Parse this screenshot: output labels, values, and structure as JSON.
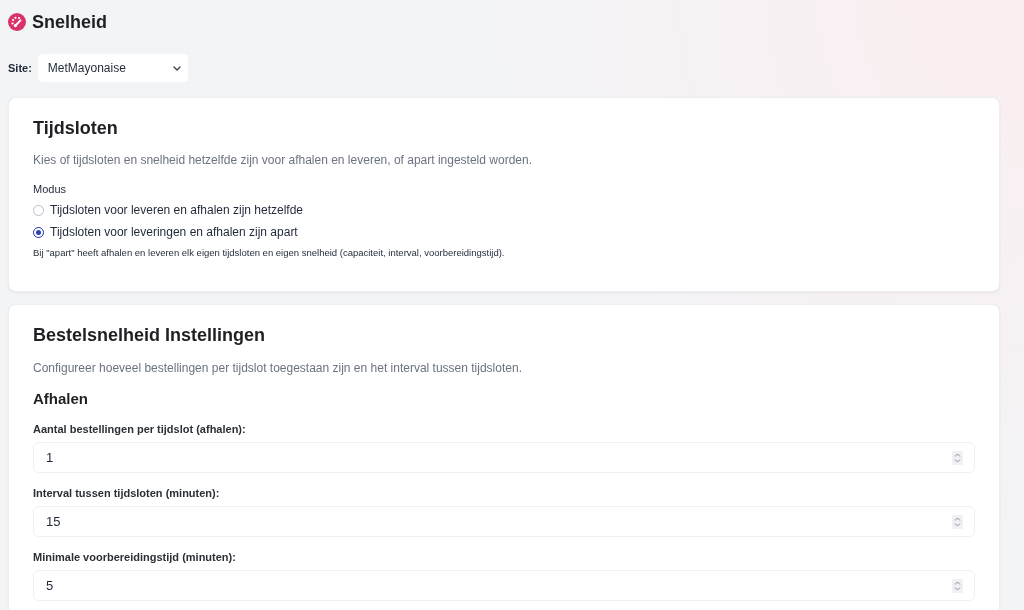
{
  "header": {
    "title": "Snelheid"
  },
  "site": {
    "label": "Site:",
    "value": "MetMayonaise"
  },
  "sections": [
    {
      "kind": "mode",
      "title": "Tijdsloten",
      "description": "Kies of tijdsloten en snelheid hetzelfde zijn voor afhalen en leveren, of apart ingesteld worden.",
      "group_label": "Modus",
      "options": [
        {
          "label": "Tijdsloten voor leveren en afhalen zijn hetzelfde",
          "selected": false
        },
        {
          "label": "Tijdsloten voor leveringen en afhalen zijn apart",
          "selected": true
        }
      ],
      "note": "Bij \"apart\" heeft afhalen en leveren elk eigen tijdsloten en eigen snelheid (capaciteit, interval, voorbereidingstijd)."
    },
    {
      "kind": "settings",
      "title": "Bestelsnelheid Instellingen",
      "description": "Configureer hoeveel bestellingen per tijdslot toegestaan zijn en het interval tussen tijdsloten.",
      "subsections": [
        {
          "title": "Afhalen",
          "fields": [
            {
              "label": "Aantal bestellingen per tijdslot (afhalen):",
              "value": "1"
            },
            {
              "label": "Interval tussen tijdsloten (minuten):",
              "value": "15"
            },
            {
              "label": "Minimale voorbereidingstijd (minuten):",
              "value": "5"
            }
          ]
        }
      ]
    }
  ]
}
